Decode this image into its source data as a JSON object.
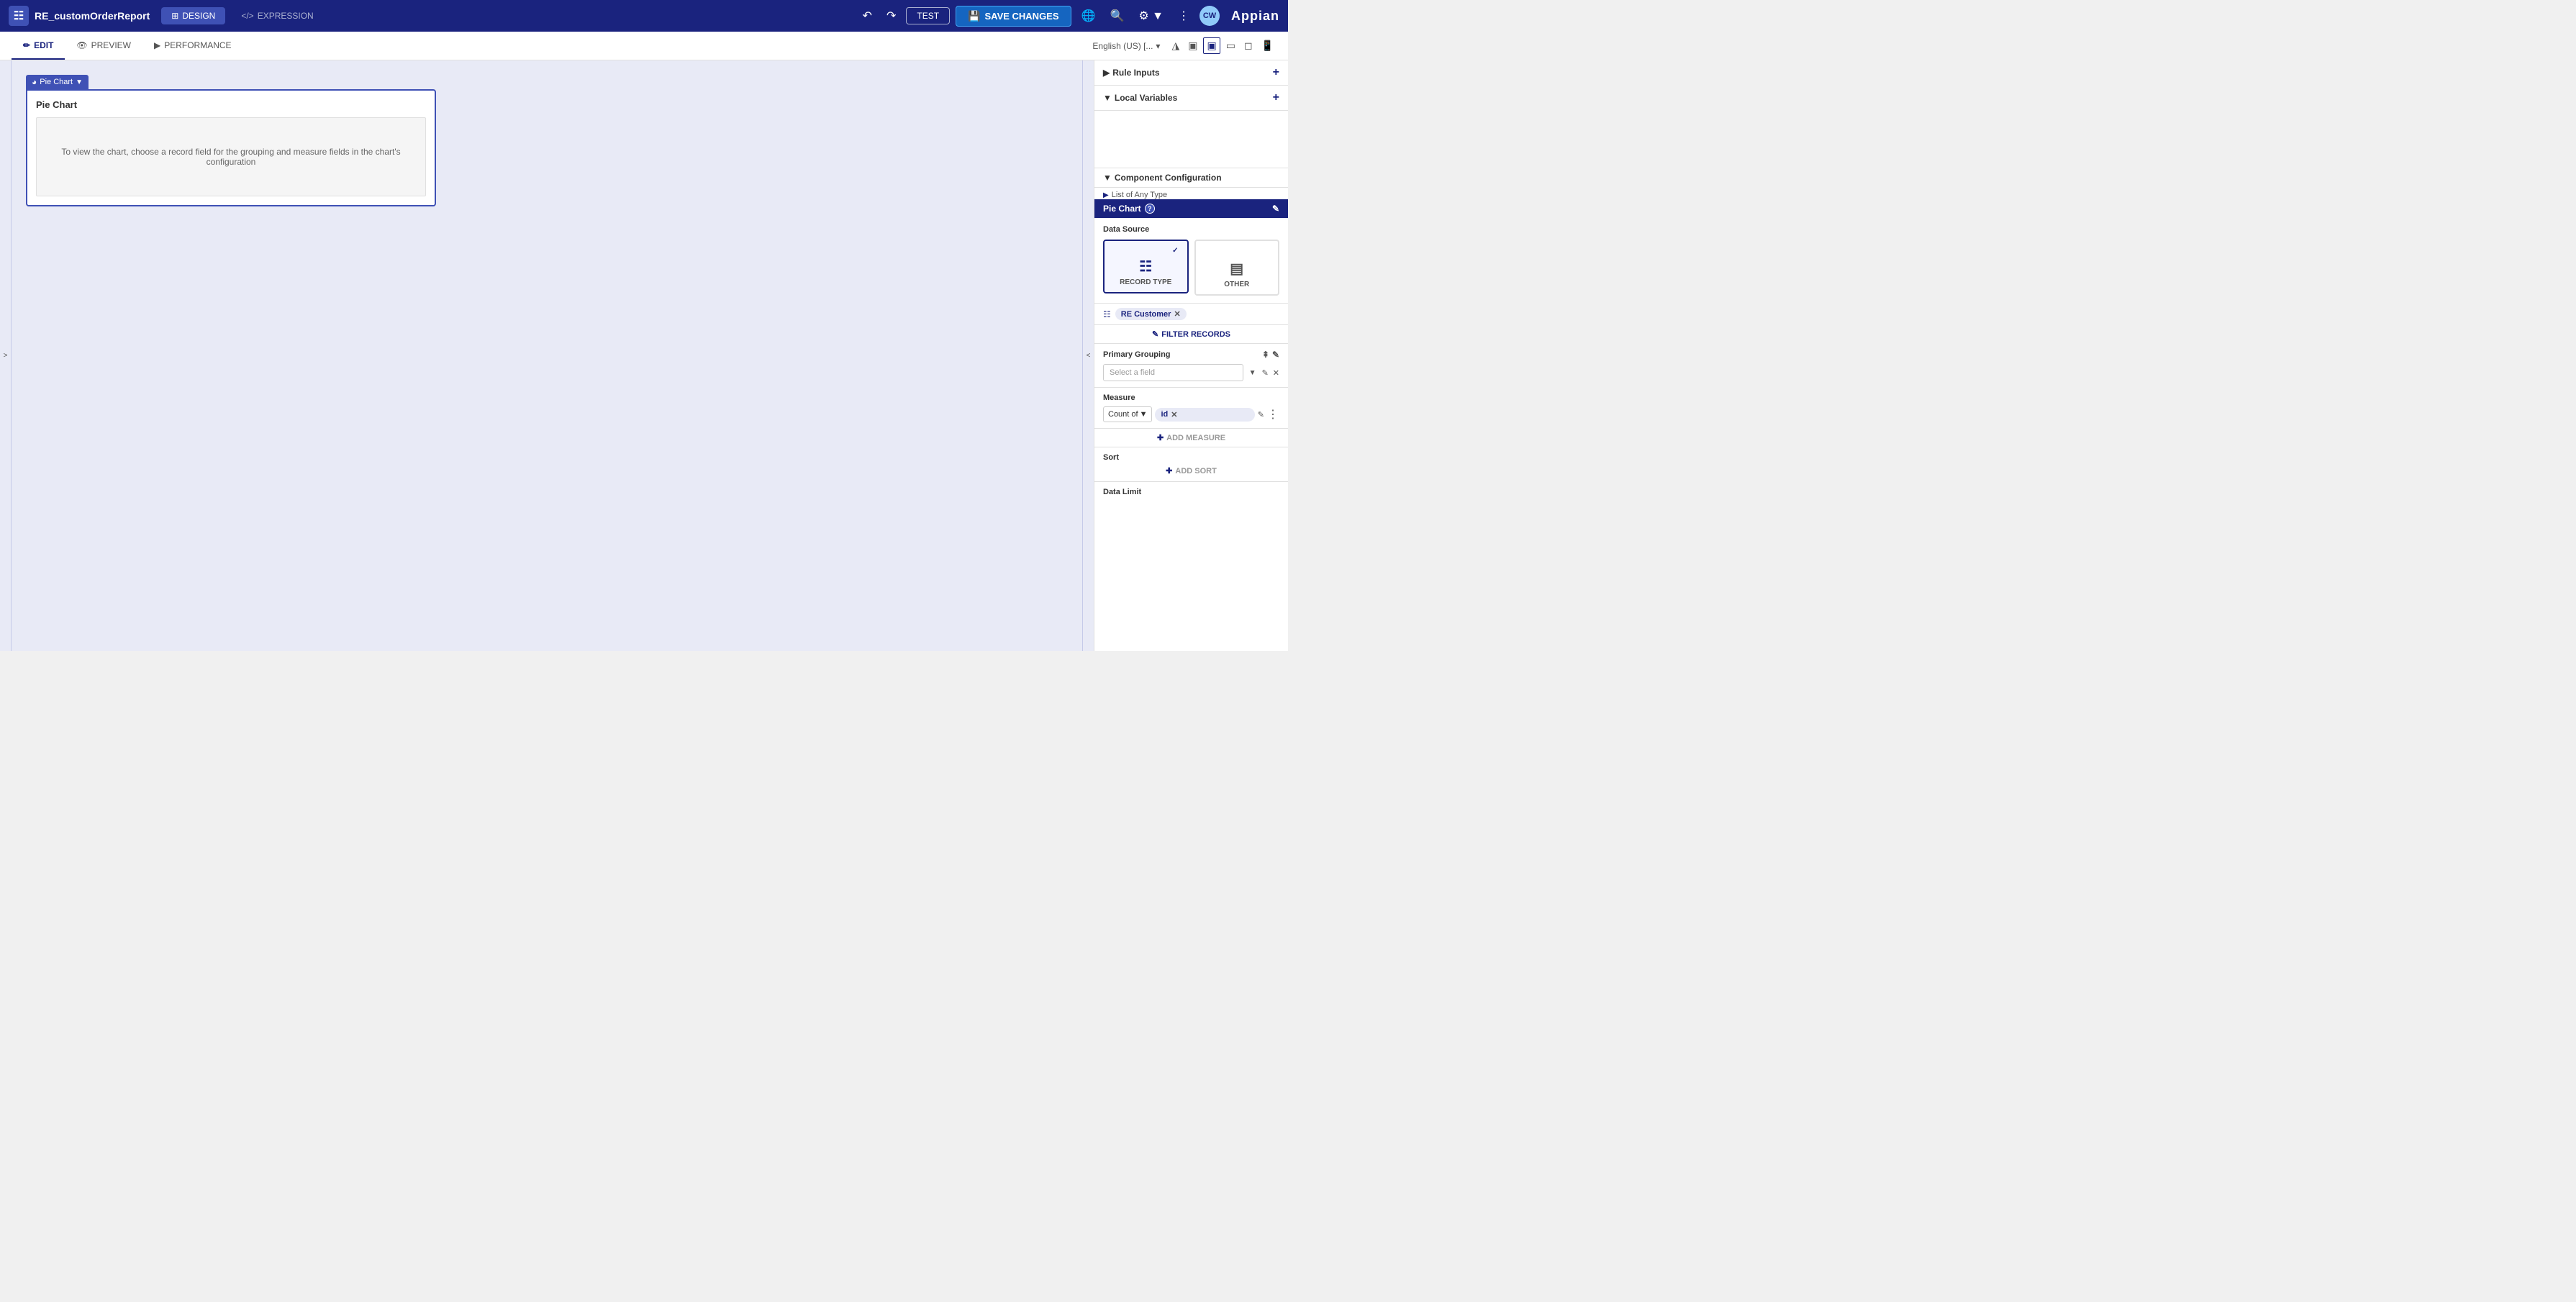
{
  "app": {
    "title": "RE_customOrderReport",
    "logo": "Appian"
  },
  "topnav": {
    "design_label": "DESIGN",
    "expression_label": "EXPRESSION",
    "test_label": "TEST",
    "save_label": "SAVE CHANGES",
    "avatar": "CW"
  },
  "tabs": {
    "edit": "EDIT",
    "preview": "PREVIEW",
    "performance": "PERFORMANCE",
    "language": "English (US) [...",
    "language_dropdown": "▾"
  },
  "canvas": {
    "component_label": "Pie Chart",
    "chart_title": "Pie Chart",
    "placeholder_text": "To view the chart, choose a record field for the grouping and measure fields in the chart's configuration"
  },
  "right_panel": {
    "rule_inputs_label": "Rule Inputs",
    "local_variables_label": "Local Variables",
    "component_config_label": "Component Configuration",
    "list_of_any_type": "List of Any Type",
    "pie_chart_label": "Pie Chart",
    "data_source_label": "Data Source",
    "record_type_label": "RECORD TYPE",
    "other_label": "OTHER",
    "re_customer_label": "RE Customer",
    "filter_records_label": "FILTER RECORDS",
    "primary_grouping_label": "Primary Grouping",
    "select_field_placeholder": "Select a field",
    "measure_label": "Measure",
    "count_of_label": "Count of",
    "measure_field": "id",
    "add_measure_label": "ADD MEASURE",
    "sort_label": "Sort",
    "add_sort_label": "ADD SORT",
    "data_limit_label": "Data Limit"
  }
}
